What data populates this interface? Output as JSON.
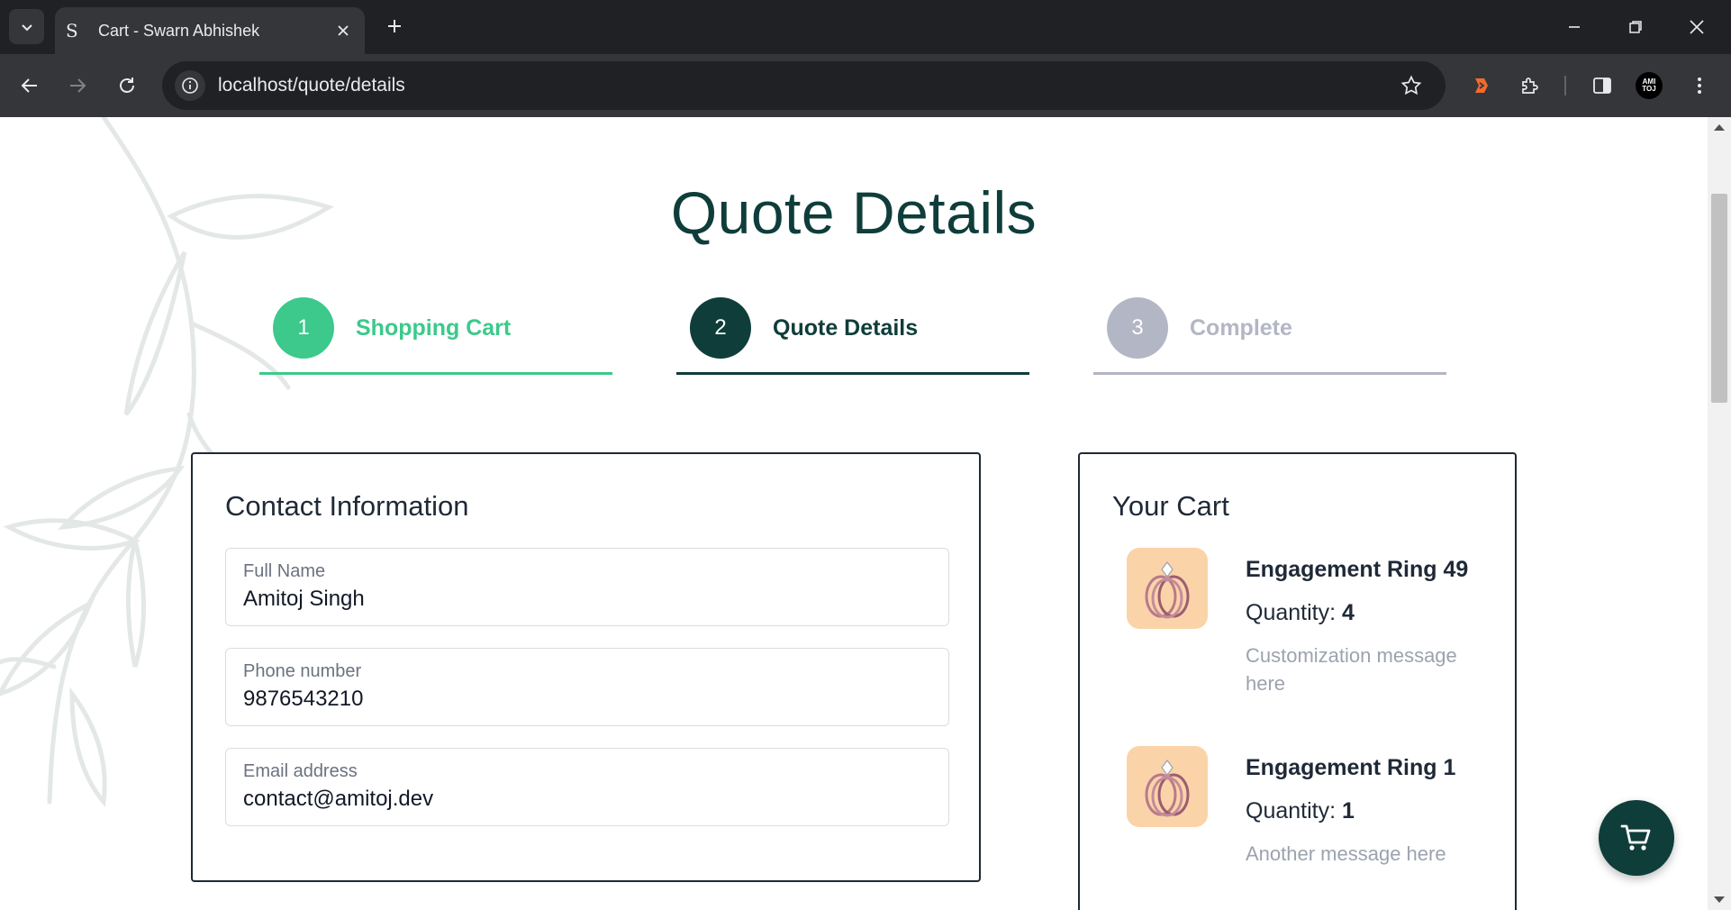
{
  "browser": {
    "tab_title": "Cart - Swarn Abhishek",
    "favicon_glyph": "S",
    "url": "localhost/quote/details",
    "profile_initials": "AMI TOJ"
  },
  "page": {
    "title": "Quote Details",
    "steps": [
      {
        "number": "1",
        "label": "Shopping Cart",
        "state": "completed",
        "color": "#3cc98b"
      },
      {
        "number": "2",
        "label": "Quote Details",
        "state": "active",
        "color": "#0f3d3a"
      },
      {
        "number": "3",
        "label": "Complete",
        "state": "pending",
        "color": "#b3b6c4"
      }
    ],
    "contact": {
      "heading": "Contact Information",
      "fields": [
        {
          "label": "Full Name",
          "value": "Amitoj Singh"
        },
        {
          "label": "Phone number",
          "value": "9876543210"
        },
        {
          "label": "Email address",
          "value": "contact@amitoj.dev"
        }
      ]
    },
    "cart": {
      "heading": "Your Cart",
      "quantity_label": "Quantity:",
      "items": [
        {
          "name": "Engagement Ring 49",
          "quantity": "4",
          "message": "Customization message here"
        },
        {
          "name": "Engagement Ring 1",
          "quantity": "1",
          "message": "Another message here"
        }
      ]
    }
  },
  "colors": {
    "accent_dark": "#0f3d3a",
    "accent_green": "#3cc98b",
    "pending_gray": "#b3b6c4",
    "thumb_bg": "#fbd3a8"
  },
  "icons": {
    "fab": "shopping-cart-icon"
  }
}
